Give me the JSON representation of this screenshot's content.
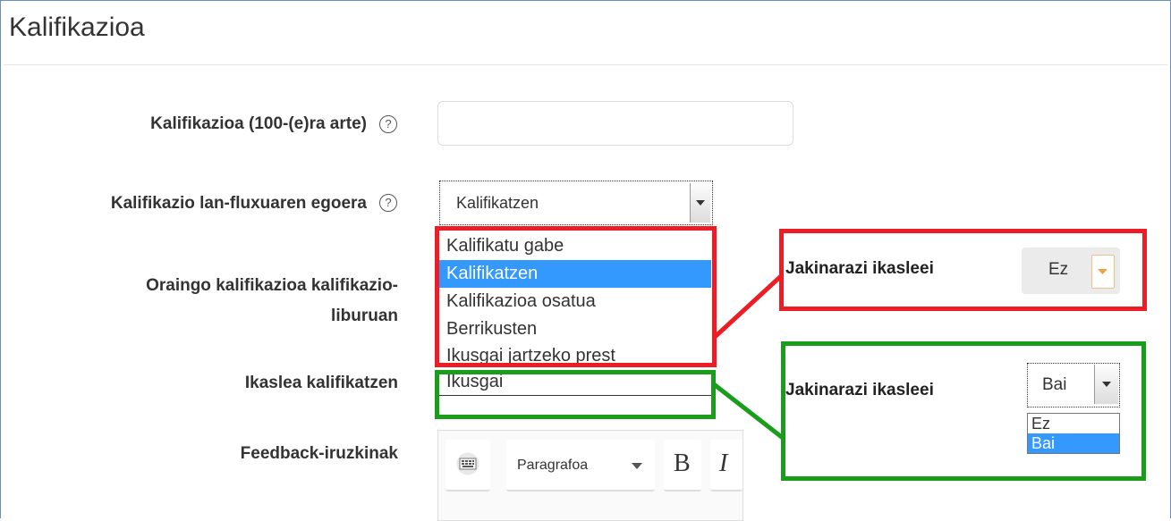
{
  "header": {
    "title": "Kalifikazioa"
  },
  "form": {
    "grade_label": "Kalifikazioa (100-(e)ra arte)",
    "workflow_label": "Kalifikazio lan-fluxuaren egoera",
    "current_label_line1": "Oraingo kalifikazioa kalifikazio-",
    "current_label_line2": "liburuan",
    "student_label": "Ikaslea kalifikatzen",
    "feedback_label": "Feedback-iruzkinak",
    "help_glyph": "?"
  },
  "workflow_select": {
    "value": "Kalifikatzen",
    "options": [
      "Kalifikatu gabe",
      "Kalifikatzen",
      "Kalifikazioa osatua",
      "Berrikusten",
      "Ikusgai jartzeko prest",
      "Ikusgai"
    ]
  },
  "callout_red": {
    "label": "Jakinarazi ikasleei",
    "value": "Ez"
  },
  "callout_green": {
    "label": "Jakinarazi ikasleei",
    "value": "Bai",
    "options": [
      "Ez",
      "Bai"
    ]
  },
  "editor": {
    "paragraph_label": "Paragrafoa",
    "bold_label": "B",
    "italic_label": "I"
  },
  "colors": {
    "red": "#ee1c24",
    "green": "#1a9d1a",
    "highlight": "#3399ff"
  }
}
